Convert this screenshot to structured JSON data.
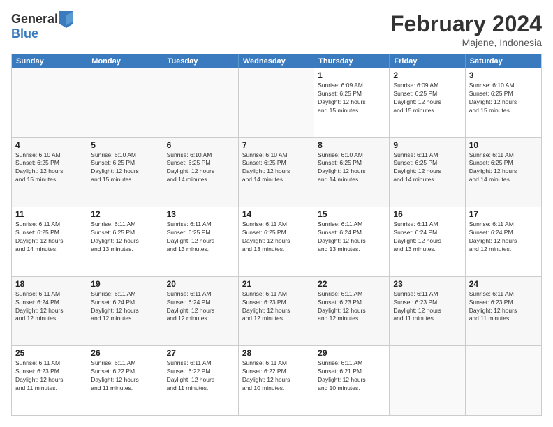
{
  "header": {
    "logo_line1": "General",
    "logo_line2": "Blue",
    "month_title": "February 2024",
    "location": "Majene, Indonesia"
  },
  "days_of_week": [
    "Sunday",
    "Monday",
    "Tuesday",
    "Wednesday",
    "Thursday",
    "Friday",
    "Saturday"
  ],
  "weeks": [
    [
      {
        "day": "",
        "info": ""
      },
      {
        "day": "",
        "info": ""
      },
      {
        "day": "",
        "info": ""
      },
      {
        "day": "",
        "info": ""
      },
      {
        "day": "1",
        "info": "Sunrise: 6:09 AM\nSunset: 6:25 PM\nDaylight: 12 hours\nand 15 minutes."
      },
      {
        "day": "2",
        "info": "Sunrise: 6:09 AM\nSunset: 6:25 PM\nDaylight: 12 hours\nand 15 minutes."
      },
      {
        "day": "3",
        "info": "Sunrise: 6:10 AM\nSunset: 6:25 PM\nDaylight: 12 hours\nand 15 minutes."
      }
    ],
    [
      {
        "day": "4",
        "info": "Sunrise: 6:10 AM\nSunset: 6:25 PM\nDaylight: 12 hours\nand 15 minutes."
      },
      {
        "day": "5",
        "info": "Sunrise: 6:10 AM\nSunset: 6:25 PM\nDaylight: 12 hours\nand 15 minutes."
      },
      {
        "day": "6",
        "info": "Sunrise: 6:10 AM\nSunset: 6:25 PM\nDaylight: 12 hours\nand 14 minutes."
      },
      {
        "day": "7",
        "info": "Sunrise: 6:10 AM\nSunset: 6:25 PM\nDaylight: 12 hours\nand 14 minutes."
      },
      {
        "day": "8",
        "info": "Sunrise: 6:10 AM\nSunset: 6:25 PM\nDaylight: 12 hours\nand 14 minutes."
      },
      {
        "day": "9",
        "info": "Sunrise: 6:11 AM\nSunset: 6:25 PM\nDaylight: 12 hours\nand 14 minutes."
      },
      {
        "day": "10",
        "info": "Sunrise: 6:11 AM\nSunset: 6:25 PM\nDaylight: 12 hours\nand 14 minutes."
      }
    ],
    [
      {
        "day": "11",
        "info": "Sunrise: 6:11 AM\nSunset: 6:25 PM\nDaylight: 12 hours\nand 14 minutes."
      },
      {
        "day": "12",
        "info": "Sunrise: 6:11 AM\nSunset: 6:25 PM\nDaylight: 12 hours\nand 13 minutes."
      },
      {
        "day": "13",
        "info": "Sunrise: 6:11 AM\nSunset: 6:25 PM\nDaylight: 12 hours\nand 13 minutes."
      },
      {
        "day": "14",
        "info": "Sunrise: 6:11 AM\nSunset: 6:25 PM\nDaylight: 12 hours\nand 13 minutes."
      },
      {
        "day": "15",
        "info": "Sunrise: 6:11 AM\nSunset: 6:24 PM\nDaylight: 12 hours\nand 13 minutes."
      },
      {
        "day": "16",
        "info": "Sunrise: 6:11 AM\nSunset: 6:24 PM\nDaylight: 12 hours\nand 13 minutes."
      },
      {
        "day": "17",
        "info": "Sunrise: 6:11 AM\nSunset: 6:24 PM\nDaylight: 12 hours\nand 12 minutes."
      }
    ],
    [
      {
        "day": "18",
        "info": "Sunrise: 6:11 AM\nSunset: 6:24 PM\nDaylight: 12 hours\nand 12 minutes."
      },
      {
        "day": "19",
        "info": "Sunrise: 6:11 AM\nSunset: 6:24 PM\nDaylight: 12 hours\nand 12 minutes."
      },
      {
        "day": "20",
        "info": "Sunrise: 6:11 AM\nSunset: 6:24 PM\nDaylight: 12 hours\nand 12 minutes."
      },
      {
        "day": "21",
        "info": "Sunrise: 6:11 AM\nSunset: 6:23 PM\nDaylight: 12 hours\nand 12 minutes."
      },
      {
        "day": "22",
        "info": "Sunrise: 6:11 AM\nSunset: 6:23 PM\nDaylight: 12 hours\nand 12 minutes."
      },
      {
        "day": "23",
        "info": "Sunrise: 6:11 AM\nSunset: 6:23 PM\nDaylight: 12 hours\nand 11 minutes."
      },
      {
        "day": "24",
        "info": "Sunrise: 6:11 AM\nSunset: 6:23 PM\nDaylight: 12 hours\nand 11 minutes."
      }
    ],
    [
      {
        "day": "25",
        "info": "Sunrise: 6:11 AM\nSunset: 6:23 PM\nDaylight: 12 hours\nand 11 minutes."
      },
      {
        "day": "26",
        "info": "Sunrise: 6:11 AM\nSunset: 6:22 PM\nDaylight: 12 hours\nand 11 minutes."
      },
      {
        "day": "27",
        "info": "Sunrise: 6:11 AM\nSunset: 6:22 PM\nDaylight: 12 hours\nand 11 minutes."
      },
      {
        "day": "28",
        "info": "Sunrise: 6:11 AM\nSunset: 6:22 PM\nDaylight: 12 hours\nand 10 minutes."
      },
      {
        "day": "29",
        "info": "Sunrise: 6:11 AM\nSunset: 6:21 PM\nDaylight: 12 hours\nand 10 minutes."
      },
      {
        "day": "",
        "info": ""
      },
      {
        "day": "",
        "info": ""
      }
    ]
  ]
}
